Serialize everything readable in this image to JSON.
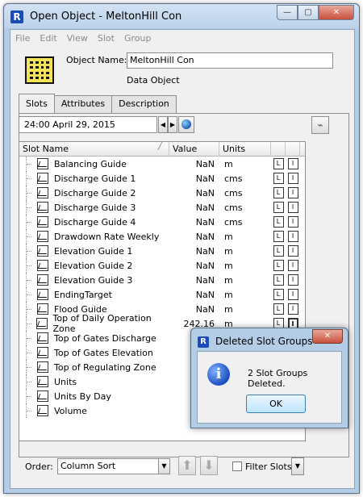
{
  "window": {
    "title": "Open Object - MeltonHill Con",
    "minimize": "—",
    "maximize": "▢",
    "close": "✕"
  },
  "menu": [
    "File",
    "Edit",
    "View",
    "Slot",
    "Group"
  ],
  "object": {
    "name_label": "Object Name:",
    "name_value": "MeltonHill Con",
    "type": "Data Object"
  },
  "tabs": [
    "Slots",
    "Attributes",
    "Description"
  ],
  "date": "24:00 April 29, 2015",
  "table": {
    "headers": {
      "name": "Slot Name",
      "value": "Value",
      "units": "Units"
    },
    "rows": [
      {
        "name": "Balancing Guide",
        "value": "NaN",
        "units": "m",
        "ex": [
          "L",
          "I"
        ]
      },
      {
        "name": "Discharge Guide 1",
        "value": "NaN",
        "units": "cms",
        "ex": [
          "L",
          "I"
        ]
      },
      {
        "name": "Discharge Guide 2",
        "value": "NaN",
        "units": "cms",
        "ex": [
          "L",
          "I"
        ]
      },
      {
        "name": "Discharge Guide 3",
        "value": "NaN",
        "units": "cms",
        "ex": [
          "L",
          "I"
        ]
      },
      {
        "name": "Discharge Guide 4",
        "value": "NaN",
        "units": "cms",
        "ex": [
          "L",
          "I"
        ]
      },
      {
        "name": "Drawdown Rate Weekly",
        "value": "NaN",
        "units": "m",
        "ex": [
          "L",
          "I"
        ]
      },
      {
        "name": "Elevation Guide 1",
        "value": "NaN",
        "units": "m",
        "ex": [
          "L",
          "I"
        ]
      },
      {
        "name": "Elevation Guide 2",
        "value": "NaN",
        "units": "m",
        "ex": [
          "L",
          "I"
        ]
      },
      {
        "name": "Elevation Guide 3",
        "value": "NaN",
        "units": "m",
        "ex": [
          "L",
          "I"
        ]
      },
      {
        "name": "EndingTarget",
        "value": "NaN",
        "units": "m",
        "ex": [
          "L",
          "I"
        ]
      },
      {
        "name": "Flood Guide",
        "value": "NaN",
        "units": "m",
        "ex": [
          "L",
          "I"
        ]
      },
      {
        "name": "Top of Daily Operation Zone",
        "value": "242.16",
        "units": "m",
        "ex": [
          "L",
          "I"
        ]
      },
      {
        "name": "Top of Gates Discharge",
        "value": "",
        "units": "",
        "ex": []
      },
      {
        "name": "Top of Gates Elevation",
        "value": "",
        "units": "",
        "ex": []
      },
      {
        "name": "Top of Regulating Zone",
        "value": "",
        "units": "",
        "ex": []
      },
      {
        "name": "Units",
        "value": "",
        "units": "",
        "ex": []
      },
      {
        "name": "Units By Day",
        "value": "",
        "units": "",
        "ex": []
      },
      {
        "name": "Volume",
        "value": "",
        "units": "",
        "ex": []
      }
    ]
  },
  "footer": {
    "order_label": "Order:",
    "order_value": "Column Sort",
    "filter_label": "Filter Slots"
  },
  "dialog": {
    "title": "Deleted Slot Groups",
    "message": "2 Slot Groups Deleted.",
    "ok": "OK"
  }
}
